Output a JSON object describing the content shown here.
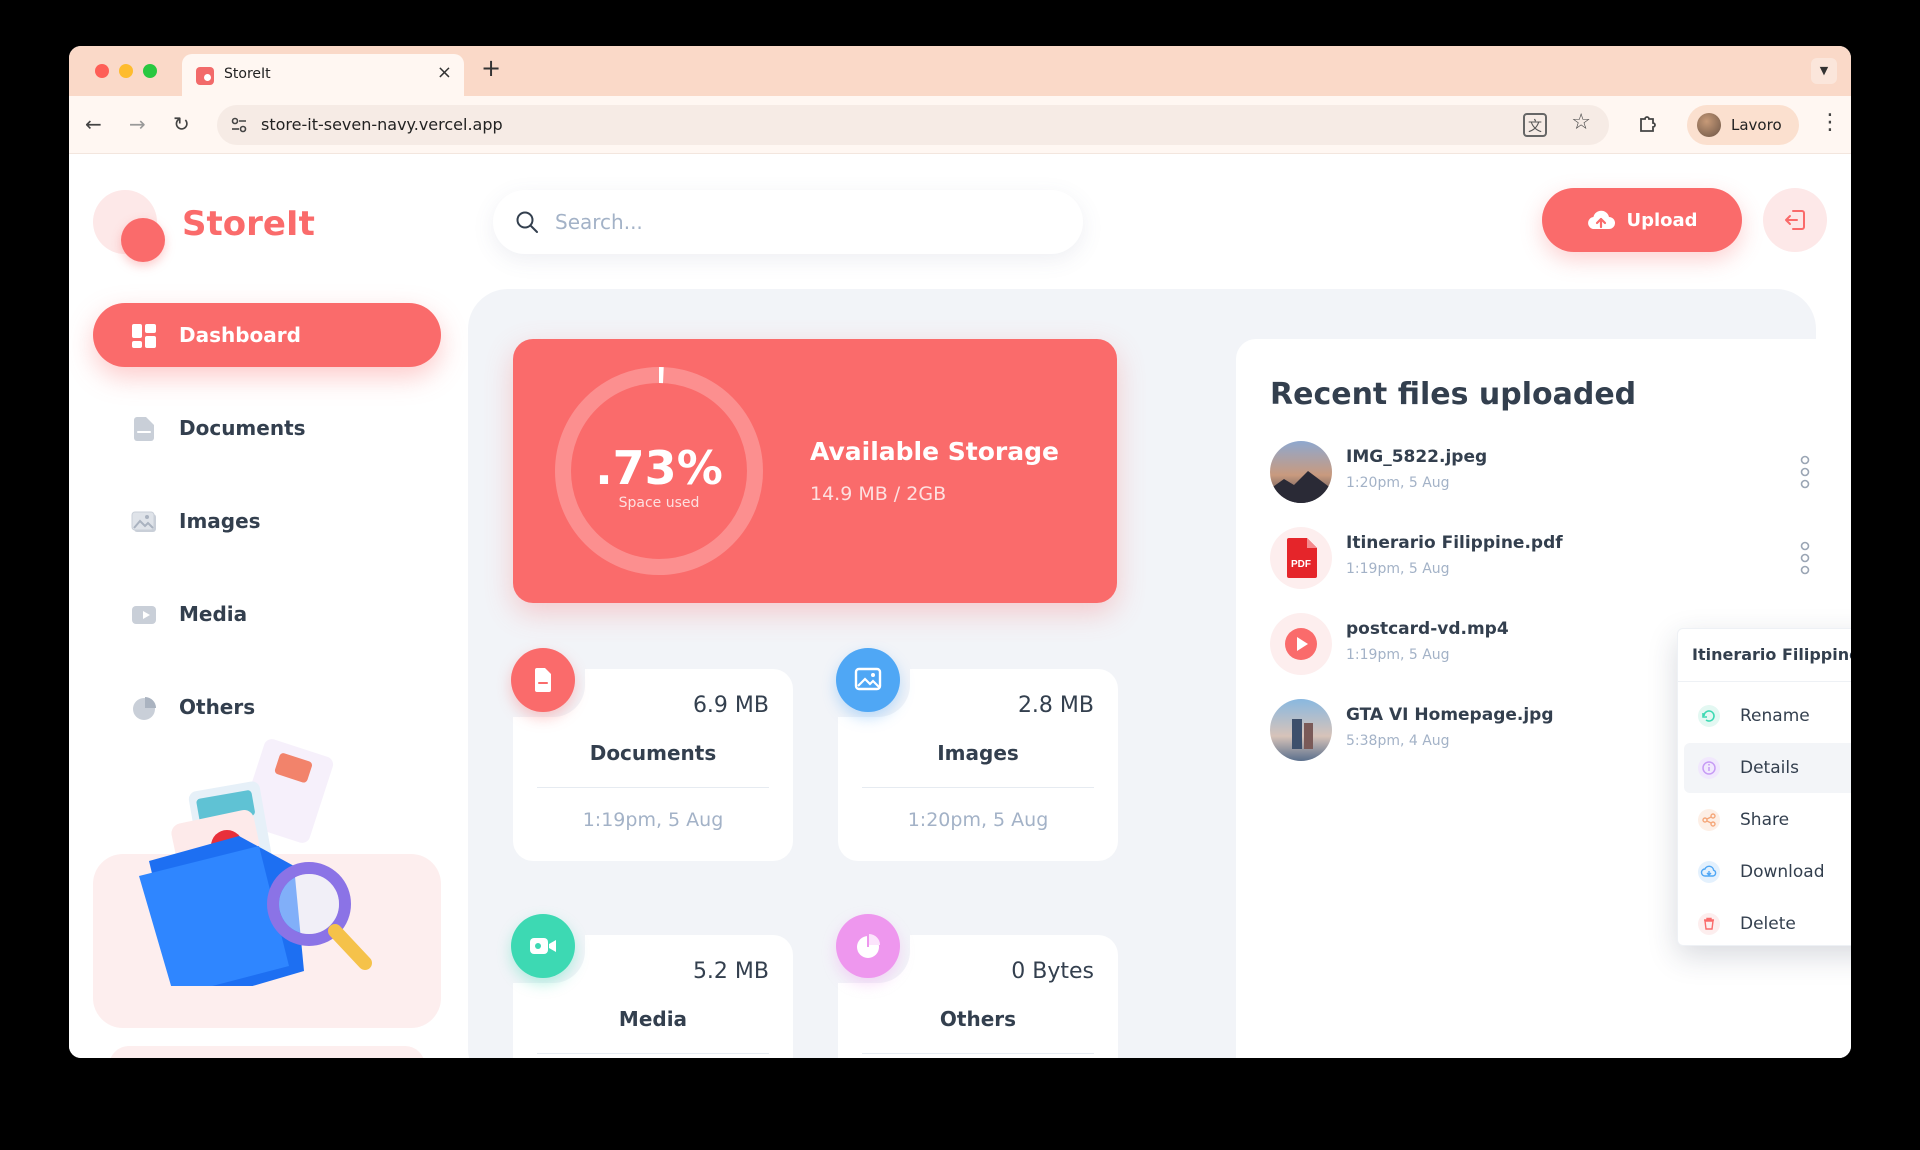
{
  "browser": {
    "tab_title": "StoreIt",
    "url": "store-it-seven-navy.vercel.app",
    "profile_name": "Lavoro",
    "translate_glyph": "文"
  },
  "app": {
    "logo_text": "StoreIt",
    "search_placeholder": "Search...",
    "upload_label": "Upload",
    "accent": "#fa6b6b"
  },
  "sidebar": {
    "items": [
      {
        "label": "Dashboard",
        "icon": "dashboard-icon",
        "active": true
      },
      {
        "label": "Documents",
        "icon": "document-icon",
        "active": false
      },
      {
        "label": "Images",
        "icon": "image-icon",
        "active": false
      },
      {
        "label": "Media",
        "icon": "video-icon",
        "active": false
      },
      {
        "label": "Others",
        "icon": "pie-icon",
        "active": false
      }
    ]
  },
  "storage": {
    "percent": ".73%",
    "percent_fraction": 0.0073,
    "subtitle": "Space used",
    "title": "Available Storage",
    "value": "14.9 MB / 2GB"
  },
  "categories": [
    {
      "name": "Documents",
      "size": "6.9 MB",
      "date": "1:19pm, 5 Aug",
      "color": "#fa6b6b"
    },
    {
      "name": "Images",
      "size": "2.8 MB",
      "date": "1:20pm, 5 Aug",
      "color": "#4fa7f5"
    },
    {
      "name": "Media",
      "size": "5.2 MB",
      "date": "",
      "color": "#3dd9b3"
    },
    {
      "name": "Others",
      "size": "0 Bytes",
      "date": "",
      "color": "#ee97ee"
    }
  ],
  "recent": {
    "title": "Recent files uploaded",
    "files": [
      {
        "name": "IMG_5822.jpeg",
        "date": "1:20pm, 5 Aug",
        "type": "image"
      },
      {
        "name": "Itinerario Filippine.pdf",
        "date": "1:19pm, 5 Aug",
        "type": "pdf",
        "pdf_badge": "PDF"
      },
      {
        "name": "postcard-vd.mp4",
        "date": "1:19pm, 5 Aug",
        "type": "video"
      },
      {
        "name": "GTA VI Homepage.jpg",
        "date": "5:38pm, 4 Aug",
        "type": "image"
      }
    ]
  },
  "dropdown": {
    "title": "Itinerario Filippine.pdf",
    "items": [
      {
        "label": "Rename",
        "icon": "rename-icon",
        "color": "#3dd9b3"
      },
      {
        "label": "Details",
        "icon": "info-icon",
        "color": "#c79cf5",
        "highlighted": true
      },
      {
        "label": "Share",
        "icon": "share-icon",
        "color": "#f5a77a"
      },
      {
        "label": "Download",
        "icon": "download-icon",
        "color": "#4fa7f5"
      },
      {
        "label": "Delete",
        "icon": "trash-icon",
        "color": "#fa6b6b"
      }
    ]
  }
}
